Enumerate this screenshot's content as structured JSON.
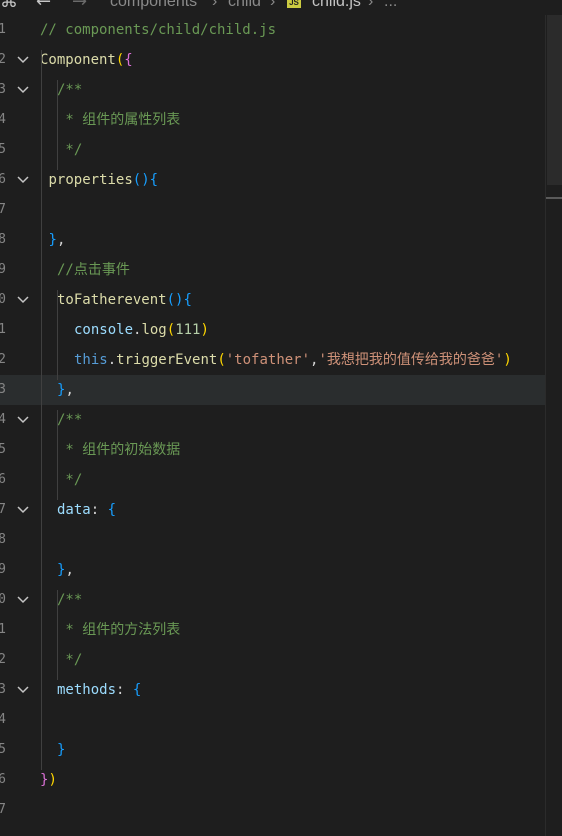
{
  "breadcrumb": {
    "segments": [
      "components",
      "child"
    ],
    "file": "child.js",
    "file_icon": "JS",
    "ellipsis": "..."
  },
  "lines": [
    {
      "num": "1",
      "fold": false,
      "indent": 0,
      "tokens": [
        {
          "t": "// components/child/child.js",
          "c": "comment"
        }
      ]
    },
    {
      "num": "2",
      "fold": true,
      "indent": 0,
      "tokens": [
        {
          "t": "Component",
          "c": "func"
        },
        {
          "t": "(",
          "c": "brace"
        },
        {
          "t": "{",
          "c": "brace2"
        }
      ]
    },
    {
      "num": "3",
      "fold": true,
      "indent": 1,
      "tokens": [
        {
          "t": "/**",
          "c": "comment"
        }
      ]
    },
    {
      "num": "4",
      "fold": false,
      "indent": 1,
      "tokens": [
        {
          "t": " * 组件的属性列表",
          "c": "comment"
        }
      ]
    },
    {
      "num": "5",
      "fold": false,
      "indent": 1,
      "tokens": [
        {
          "t": " */",
          "c": "comment"
        }
      ]
    },
    {
      "num": "6",
      "fold": true,
      "indent": 0.5,
      "tokens": [
        {
          "t": "properties",
          "c": "func"
        },
        {
          "t": "()",
          "c": "brace3"
        },
        {
          "t": "{",
          "c": "brace3"
        }
      ]
    },
    {
      "num": "7",
      "fold": false,
      "indent": 0,
      "tokens": []
    },
    {
      "num": "8",
      "fold": false,
      "indent": 0.5,
      "tokens": [
        {
          "t": "}",
          "c": "brace3"
        },
        {
          "t": ",",
          "c": "punct"
        }
      ]
    },
    {
      "num": "9",
      "fold": false,
      "indent": 1,
      "tokens": [
        {
          "t": "//点击事件",
          "c": "comment"
        }
      ]
    },
    {
      "num": "0",
      "fold": true,
      "indent": 1,
      "tokens": [
        {
          "t": "toFatherevent",
          "c": "func"
        },
        {
          "t": "()",
          "c": "brace3"
        },
        {
          "t": "{",
          "c": "brace3"
        }
      ]
    },
    {
      "num": "1",
      "fold": false,
      "indent": 2,
      "tokens": [
        {
          "t": "console",
          "c": "prop"
        },
        {
          "t": ".",
          "c": "punct"
        },
        {
          "t": "log",
          "c": "func"
        },
        {
          "t": "(",
          "c": "brace"
        },
        {
          "t": "111",
          "c": "num"
        },
        {
          "t": ")",
          "c": "brace"
        }
      ]
    },
    {
      "num": "2",
      "fold": false,
      "indent": 2,
      "tokens": [
        {
          "t": "this",
          "c": "kw"
        },
        {
          "t": ".",
          "c": "punct"
        },
        {
          "t": "triggerEvent",
          "c": "func"
        },
        {
          "t": "(",
          "c": "brace"
        },
        {
          "t": "'tofather'",
          "c": "str"
        },
        {
          "t": ",",
          "c": "punct"
        },
        {
          "t": "'我想把我的值传给我的爸爸'",
          "c": "str"
        },
        {
          "t": ")",
          "c": "brace"
        }
      ]
    },
    {
      "num": "3",
      "fold": false,
      "indent": 1,
      "current": true,
      "tokens": [
        {
          "t": "}",
          "c": "brace3"
        },
        {
          "t": ",",
          "c": "punct"
        }
      ]
    },
    {
      "num": "4",
      "fold": true,
      "indent": 1,
      "tokens": [
        {
          "t": "/**",
          "c": "comment"
        }
      ]
    },
    {
      "num": "5",
      "fold": false,
      "indent": 1,
      "tokens": [
        {
          "t": " * 组件的初始数据",
          "c": "comment"
        }
      ]
    },
    {
      "num": "6",
      "fold": false,
      "indent": 1,
      "tokens": [
        {
          "t": " */",
          "c": "comment"
        }
      ]
    },
    {
      "num": "7",
      "fold": true,
      "indent": 1,
      "tokens": [
        {
          "t": "data",
          "c": "prop"
        },
        {
          "t": ": ",
          "c": "punct"
        },
        {
          "t": "{",
          "c": "brace3"
        }
      ]
    },
    {
      "num": "8",
      "fold": false,
      "indent": 0,
      "tokens": []
    },
    {
      "num": "9",
      "fold": false,
      "indent": 1,
      "tokens": [
        {
          "t": "}",
          "c": "brace3"
        },
        {
          "t": ",",
          "c": "punct"
        }
      ]
    },
    {
      "num": "0",
      "fold": true,
      "indent": 1,
      "tokens": [
        {
          "t": "/**",
          "c": "comment"
        }
      ]
    },
    {
      "num": "1",
      "fold": false,
      "indent": 1,
      "tokens": [
        {
          "t": " * 组件的方法列表",
          "c": "comment"
        }
      ]
    },
    {
      "num": "2",
      "fold": false,
      "indent": 1,
      "tokens": [
        {
          "t": " */",
          "c": "comment"
        }
      ]
    },
    {
      "num": "3",
      "fold": true,
      "indent": 1,
      "tokens": [
        {
          "t": "methods",
          "c": "prop"
        },
        {
          "t": ": ",
          "c": "punct"
        },
        {
          "t": "{",
          "c": "brace3"
        }
      ]
    },
    {
      "num": "4",
      "fold": false,
      "indent": 0,
      "tokens": []
    },
    {
      "num": "5",
      "fold": false,
      "indent": 1,
      "tokens": [
        {
          "t": "}",
          "c": "brace3"
        }
      ]
    },
    {
      "num": "6",
      "fold": false,
      "indent": 0,
      "tokens": [
        {
          "t": "}",
          "c": "brace2"
        },
        {
          "t": ")",
          "c": "brace"
        }
      ]
    },
    {
      "num": "7",
      "fold": false,
      "indent": 0,
      "tokens": []
    }
  ]
}
